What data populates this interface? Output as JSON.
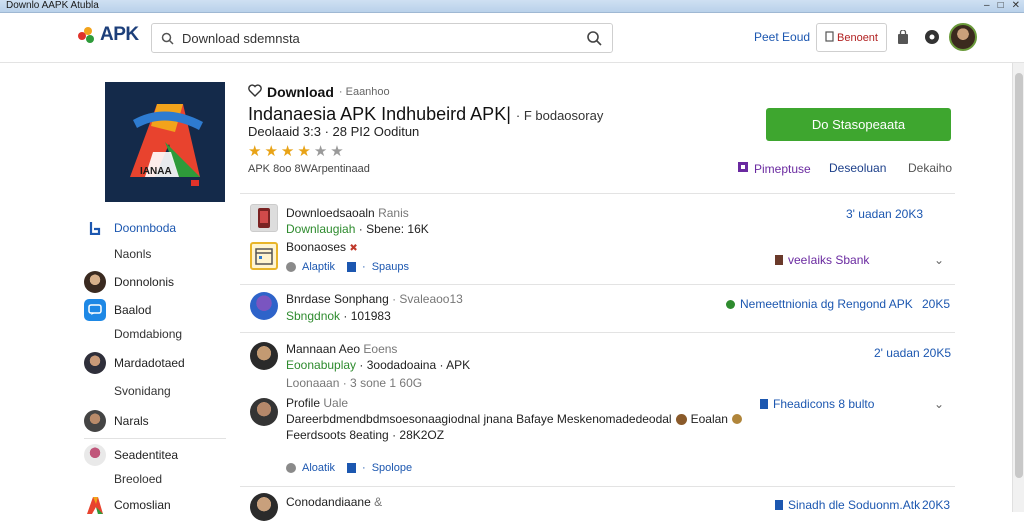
{
  "window": {
    "title": "Downlo AAPK Atubla",
    "controls": [
      "–",
      "□",
      "✕"
    ]
  },
  "header": {
    "logo_text": "APK",
    "search_placeholder": "Download sdemnsta",
    "link": "Peet Eoud",
    "account_button": "Benoent",
    "icons": [
      "bag-icon",
      "help-icon",
      "avatar"
    ]
  },
  "hero": {
    "download_label": "Download",
    "download_sub": "· Eaanhoo",
    "title": "Indanaesia APK Indhubeird APK|",
    "title_extra": "· F bodaosoray",
    "developer": "Deolaaid 3:3 · 28 PI2 Ooditun",
    "rating": 4,
    "rating_max": 6,
    "meta": "APK 8oo 8WArpentinaad",
    "download_button": "Do Stasopeaata",
    "links": [
      {
        "label": "Pimeptuse",
        "color": "#6a2aa0",
        "icon": "share-icon"
      },
      {
        "label": "Deseoluan",
        "color": "#1c3f8a"
      },
      {
        "label": "Dekaiho",
        "color": "#555555"
      }
    ]
  },
  "sidebar": {
    "items": [
      {
        "label": "Doonnboda",
        "sub": "Naonls",
        "icon": "home-icon",
        "color": "#1c57b0"
      },
      {
        "label": "Donnolonis",
        "sub": "",
        "icon": "avatar"
      },
      {
        "label": "Baalod",
        "sub": "Domdabiong",
        "icon": "chat-icon"
      },
      {
        "label": "Mardadotaed",
        "sub": "Svonidang",
        "icon": "avatar"
      },
      {
        "label": "Narals",
        "sub": "",
        "icon": "avatar"
      },
      {
        "label": "Seadentitea",
        "sub": "Breoloed",
        "icon": "avatar"
      },
      {
        "label": "Comoslian",
        "sub": "",
        "icon": "app-icon"
      }
    ]
  },
  "feed": {
    "item1": {
      "title": "Downloedsaoaln",
      "title_sub": "Ranis",
      "line2_green": "Downlaugiah",
      "line2_rest": "· Sbene: 16K",
      "line3": "Boonaoses",
      "date": "3' uadan 20K3",
      "tag": "veeIaiks Sbank",
      "action1": "Alaptik",
      "action2": "Spaups"
    },
    "item2": {
      "title": "Bnrdase Sonphang",
      "title_sub": "· Svaleaoo13",
      "line2_green": "Sbngdnok",
      "line2_rest": "· 101983",
      "right": "Nemeettnionia dg Rengond APK",
      "right_num": "20K5"
    },
    "item3": {
      "title": "Mannaan Aeo",
      "title_sub": "Eoens",
      "line2_green": "Eoonabuplay",
      "line2_rest": "· 3oodadoaina · APK",
      "line3": "Loonaaan · 3 sone 1 60G",
      "date": "2' uadan 20K5"
    },
    "item4": {
      "title": "Profile",
      "title_sub": "Uale",
      "body": "Dareerbdmendbdmsoesonaagiodnal jnana Bafaye Meskenomadedeodal",
      "body_tail": "Eoalan",
      "line2": "Feerdsoots 8eating · 28K2OZ",
      "right": "Fheadicons 8 bulto",
      "action1": "Aloatik",
      "action2": "Spolope"
    },
    "item5": {
      "title": "Conodandiaane",
      "title_sub": "&",
      "right": "Sinadh dle Soduonm.Atk",
      "right_num": "20K3"
    }
  }
}
